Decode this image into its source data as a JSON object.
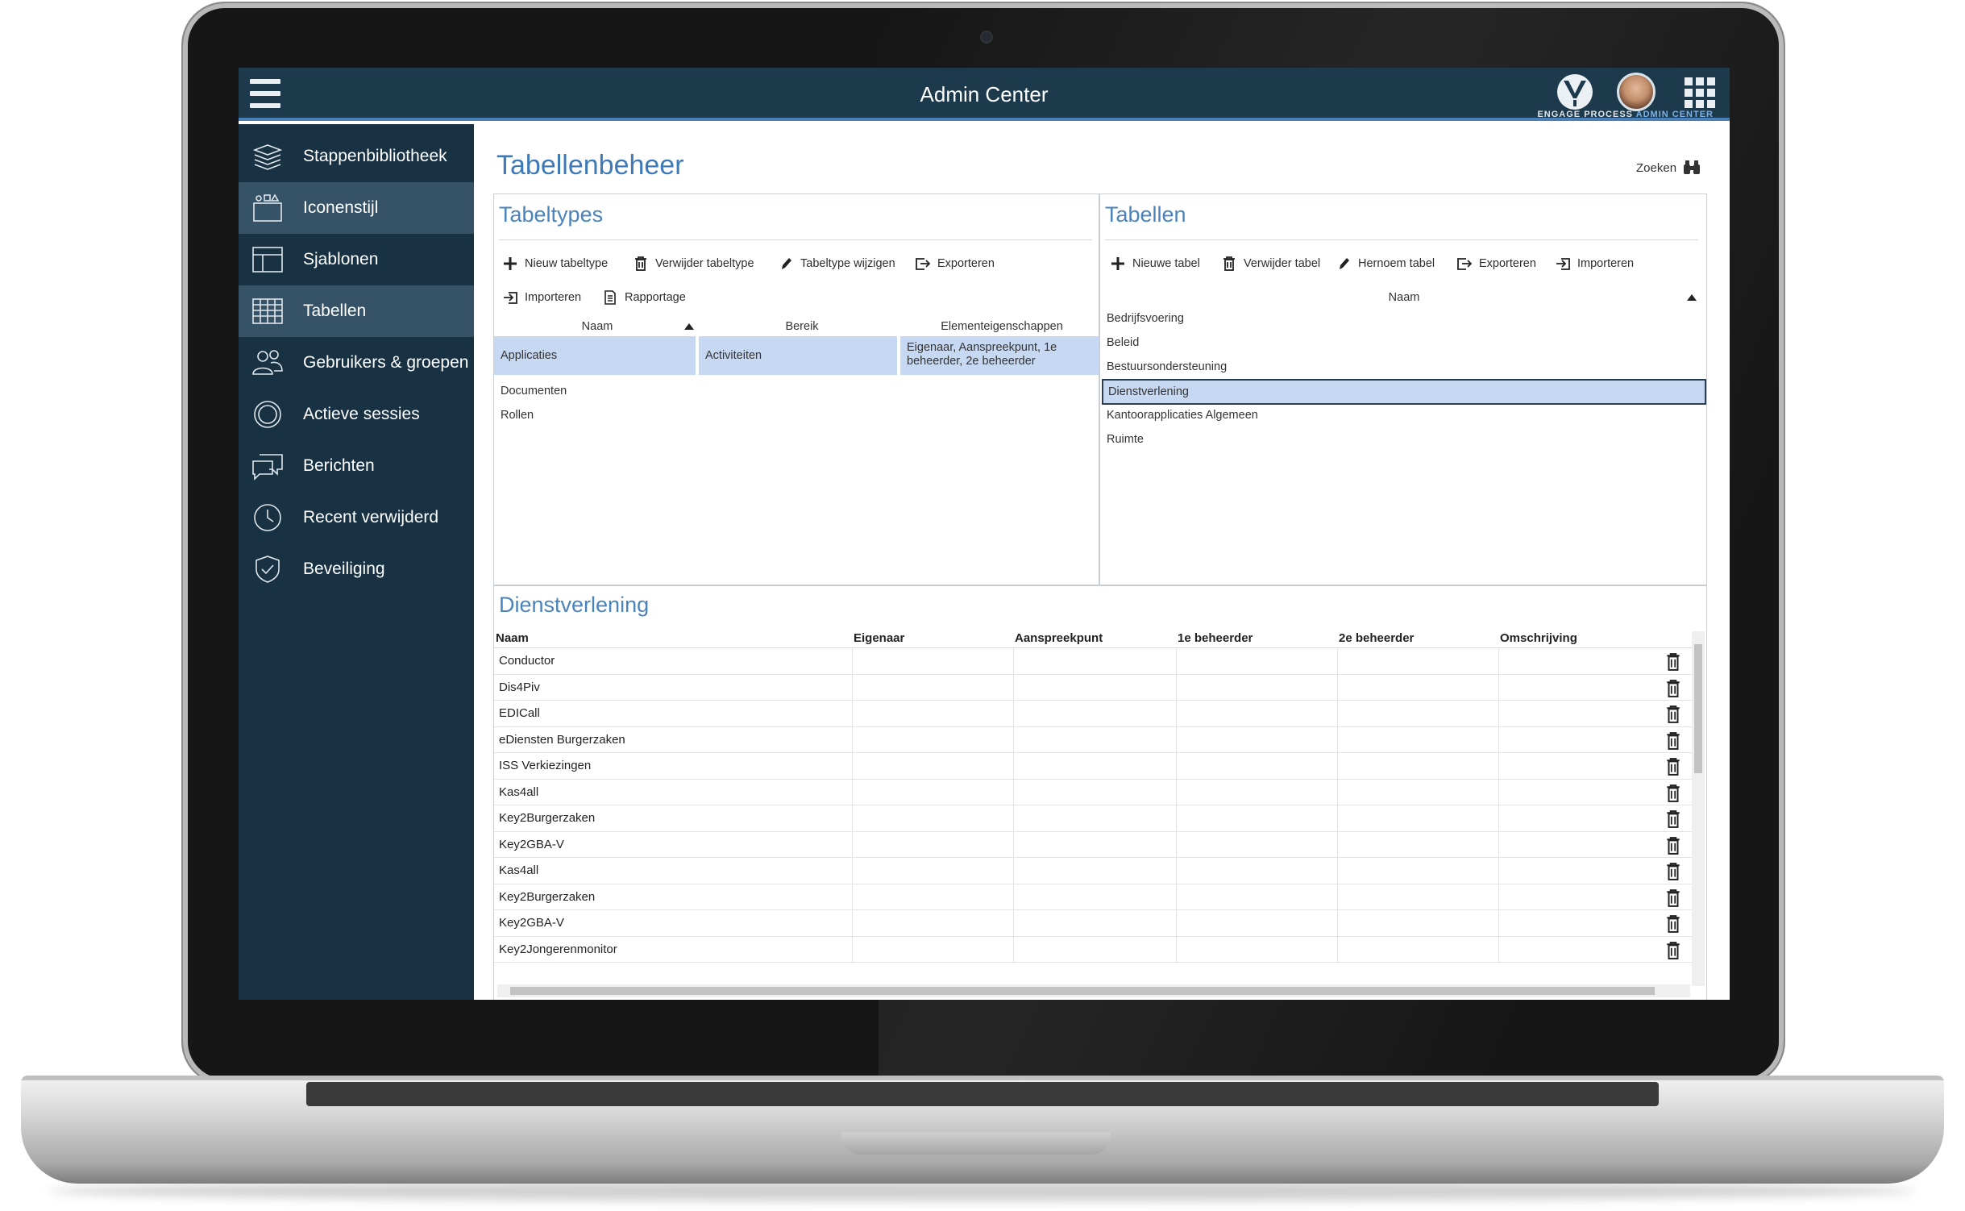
{
  "app": {
    "title": "Admin Center",
    "brand_line_1": "ENGAGE PROCESS",
    "brand_line_2": "ADMIN CENTER"
  },
  "colors": {
    "topbar": "#1c3a4c",
    "sidebar": "#183244",
    "sidebar_active": "#365266",
    "accent_blue": "#3e7ab7",
    "selection": "#c6d8f2"
  },
  "sidebar": {
    "items": [
      {
        "label": "Stappenbibliotheek",
        "icon": "layers-icon",
        "active": false
      },
      {
        "label": "Iconenstijl",
        "icon": "icon-style-icon",
        "active": true
      },
      {
        "label": "Sjablonen",
        "icon": "template-icon",
        "active": false
      },
      {
        "label": "Tabellen",
        "icon": "table-icon",
        "active": true
      },
      {
        "label": "Gebruikers & groepen",
        "icon": "users-icon",
        "active": false
      },
      {
        "label": "Actieve sessies",
        "icon": "sessions-icon",
        "active": false
      },
      {
        "label": "Berichten",
        "icon": "messages-icon",
        "active": false
      },
      {
        "label": "Recent verwijderd",
        "icon": "clock-icon",
        "active": false
      },
      {
        "label": "Beveiliging",
        "icon": "shield-icon",
        "active": false
      }
    ]
  },
  "main": {
    "title": "Tabellenbeheer",
    "search_label": "Zoeken",
    "tabeltypes": {
      "title": "Tabeltypes",
      "toolbar": {
        "new": "Nieuw tabeltype",
        "delete": "Verwijder tabeltype",
        "edit": "Tabeltype wijzigen",
        "export": "Exporteren",
        "import": "Importeren",
        "report": "Rapportage"
      },
      "columns": {
        "name": "Naam",
        "scope": "Bereik",
        "properties": "Elementeigenschappen"
      },
      "selected_row": {
        "name": "Applicaties",
        "scope": "Activiteiten",
        "properties": "Eigenaar, Aanspreekpunt, 1e beheerder, 2e beheerder"
      },
      "other_rows": [
        "Documenten",
        "Rollen"
      ]
    },
    "tabellen": {
      "title": "Tabellen",
      "toolbar": {
        "new": "Nieuwe tabel",
        "delete": "Verwijder tabel",
        "rename": "Hernoem tabel",
        "export": "Exporteren",
        "import": "Importeren"
      },
      "column": "Naam",
      "rows": [
        "Bedrijfsvoering",
        "Beleid",
        "Bestuursondersteuning",
        "Dienstverlening",
        "Kantoorapplicaties Algemeen",
        "Ruimte"
      ],
      "selected": "Dienstverlening"
    },
    "detail": {
      "title": "Dienstverlening",
      "columns": [
        "Naam",
        "Eigenaar",
        "Aanspreekpunt",
        "1e beheerder",
        "2e beheerder",
        "Omschrijving"
      ],
      "rows": [
        "Conductor",
        "Dis4Piv",
        "EDICall",
        "eDiensten Burgerzaken",
        "ISS Verkiezingen",
        "Kas4all",
        "Key2Burgerzaken",
        "Key2GBA-V",
        "Kas4all",
        "Key2Burgerzaken",
        "Key2GBA-V",
        "Key2Jongerenmonitor"
      ]
    }
  }
}
